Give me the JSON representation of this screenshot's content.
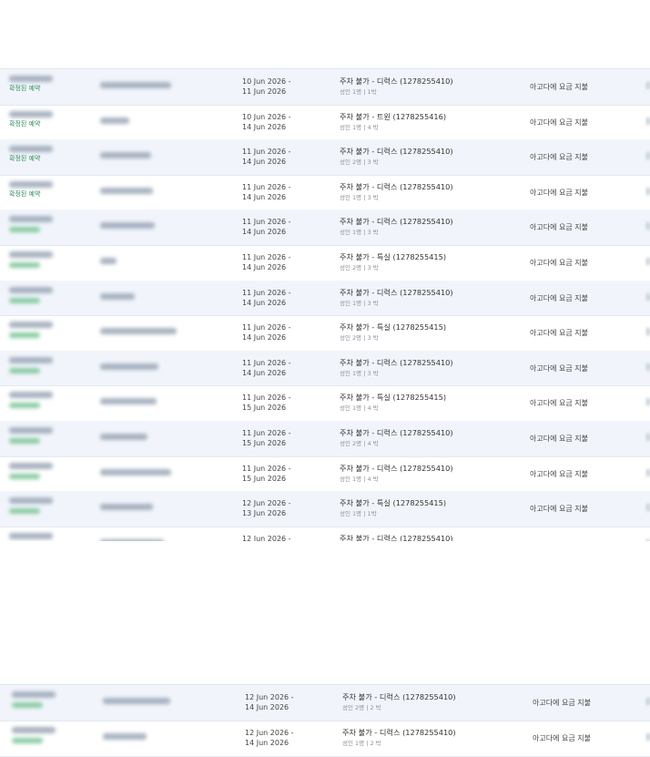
{
  "section1_rows": [
    {
      "status": "확정된 예약",
      "date_from": "10 Jun 2026 -",
      "date_to": "11 Jun 2026",
      "room": "주차 불가 - 디럭스 (1278255410)",
      "occupancy": "성인 1명 | 1박",
      "payment": "아고다에 요금 지불"
    },
    {
      "status": "확정된 예약",
      "date_from": "10 Jun 2026 -",
      "date_to": "14 Jun 2026",
      "room": "주차 불가 - 트윈 (1278255416)",
      "occupancy": "성인 1명 | 4 박",
      "payment": "아고다에 요금 지불"
    },
    {
      "status": "확정된 예약",
      "date_from": "11 Jun 2026 -",
      "date_to": "14 Jun 2026",
      "room": "주차 불가 - 디럭스 (1278255410)",
      "occupancy": "성인 2명 | 3 박",
      "payment": "아고다에 요금 지불"
    },
    {
      "status": "확정된 예약",
      "date_from": "11 Jun 2026 -",
      "date_to": "14 Jun 2026",
      "room": "주차 불가 - 디럭스 (1278255410)",
      "occupancy": "성인 1명 | 3 박",
      "payment": "아고다에 요금 지불"
    },
    {
      "status": "",
      "date_from": "11 Jun 2026 -",
      "date_to": "14 Jun 2026",
      "room": "주차 불가 - 디럭스 (1278255410)",
      "occupancy": "성인 1명 | 3 박",
      "payment": "아고다에 요금 지불"
    },
    {
      "status": "",
      "date_from": "11 Jun 2026 -",
      "date_to": "14 Jun 2026",
      "room": "주차 불가 - 특실 (1278255415)",
      "occupancy": "성인 2명 | 3 박",
      "payment": "아고다에 요금 지불"
    },
    {
      "status": "",
      "date_from": "11 Jun 2026 -",
      "date_to": "14 Jun 2026",
      "room": "주차 불가 - 디럭스 (1278255410)",
      "occupancy": "성인 1명 | 3 박",
      "payment": "아고다에 요금 지불"
    },
    {
      "status": "",
      "date_from": "11 Jun 2026 -",
      "date_to": "14 Jun 2026",
      "room": "주차 불가 - 특실 (1278255415)",
      "occupancy": "성인 2명 | 3 박",
      "payment": "아고다에 요금 지불"
    },
    {
      "status": "",
      "date_from": "11 Jun 2026 -",
      "date_to": "14 Jun 2026",
      "room": "주차 불가 - 디럭스 (1278255410)",
      "occupancy": "성인 1명 | 3 박",
      "payment": "아고다에 요금 지불"
    },
    {
      "status": "",
      "date_from": "11 Jun 2026 -",
      "date_to": "15 Jun 2026",
      "room": "주차 불가 - 특실 (1278255415)",
      "occupancy": "성인 1명 | 4 박",
      "payment": "아고다에 요금 지불"
    },
    {
      "status": "",
      "date_from": "11 Jun 2026 -",
      "date_to": "15 Jun 2026",
      "room": "주차 불가 - 디럭스 (1278255410)",
      "occupancy": "성인 2명 | 4 박",
      "payment": "아고다에 요금 지불"
    },
    {
      "status": "",
      "date_from": "11 Jun 2026 -",
      "date_to": "15 Jun 2026",
      "room": "주차 불가 - 디럭스 (1278255410)",
      "occupancy": "성인 1명 | 4 박",
      "payment": "아고다에 요금 지불"
    },
    {
      "status": "",
      "date_from": "12 Jun 2026 -",
      "date_to": "13 Jun 2026",
      "room": "주차 불가 - 특실 (1278255415)",
      "occupancy": "성인 1명 | 1박",
      "payment": "아고다에 요금 지불"
    },
    {
      "status": "",
      "date_from": "12 Jun 2026 -",
      "date_to": "",
      "room": "주차 불가 - 디럭스 (1278255410)",
      "occupancy": "",
      "payment": ""
    }
  ],
  "section2_rows": [
    {
      "status": "",
      "date_from": "12 Jun 2026 -",
      "date_to": "14 Jun 2026",
      "room": "주차 불가 - 디럭스 (1278255410)",
      "occupancy": "성인 2명 | 2 박",
      "payment": "아고다에 요금 지불"
    },
    {
      "status": "",
      "date_from": "12 Jun 2026 -",
      "date_to": "14 Jun 2026",
      "room": "주차 불가 - 디럭스 (1278255410)",
      "occupancy": "성인 1명 | 2 박",
      "payment": "아고다에 요금 지불"
    }
  ]
}
